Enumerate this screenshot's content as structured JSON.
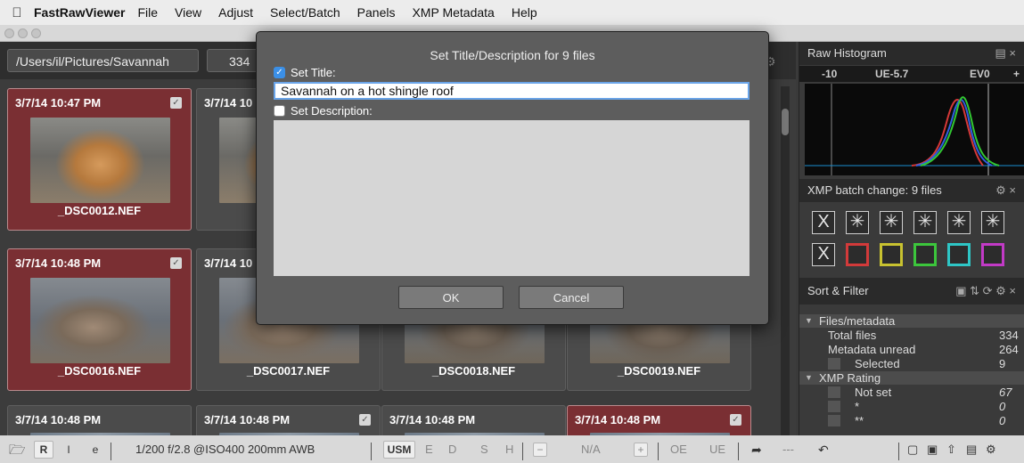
{
  "menubar": {
    "app_name": "FastRawViewer",
    "items": [
      "File",
      "View",
      "Adjust",
      "Select/Batch",
      "Panels",
      "XMP Metadata",
      "Help"
    ]
  },
  "pathbar": {
    "path": "/Users/il/Pictures/Savannah",
    "count": "334"
  },
  "thumbnails": [
    {
      "time": "3/7/14 10:47 PM",
      "file": "_DSC0012.NEF"
    },
    {
      "time": "3/7/14 10",
      "file": "_D"
    },
    {
      "time": "3/7/14 10:48 PM",
      "file": "_DSC0016.NEF"
    },
    {
      "time": "3/7/14 10",
      "file": "_DSC0017.NEF"
    },
    {
      "time": "",
      "file": "_DSC0018.NEF"
    },
    {
      "time": "",
      "file": "_DSC0019.NEF"
    },
    {
      "time": "3/7/14 10:48 PM",
      "file": ""
    },
    {
      "time": "3/7/14 10:48 PM",
      "file": ""
    },
    {
      "time": "3/7/14 10:48 PM",
      "file": ""
    },
    {
      "time": "3/7/14 10:48 PM",
      "file": ""
    }
  ],
  "dialog": {
    "title": "Set Title/Description for 9 files",
    "set_title_label": "Set Title:",
    "title_value": "Savannah on a hot shingle roof",
    "set_description_label": "Set Description:",
    "description_value": "",
    "ok_label": "OK",
    "cancel_label": "Cancel"
  },
  "histogram": {
    "header": "Raw Histogram",
    "labels": {
      "l1": "-10",
      "l2": "UE-5.7",
      "l3": "EV0",
      "l4": "+"
    }
  },
  "xmp_batch": {
    "header": "XMP batch change: 9 files",
    "clear_glyph": "X",
    "star_glyph": "✳"
  },
  "colors": {
    "red": "#d23a3a",
    "yellow": "#c8c230",
    "green": "#3cc63c",
    "cyan": "#2ec6c6",
    "purple": "#c23ac6",
    "selected": "#7a2f33",
    "accent": "#3b8fe6"
  },
  "sort_filter": {
    "header": "Sort & Filter",
    "files_metadata": "Files/metadata",
    "total_files_label": "Total files",
    "total_files": "334",
    "metadata_unread_label": "Metadata unread",
    "metadata_unread": "264",
    "selected_label": "Selected",
    "selected": "9",
    "xmp_rating": "XMP Rating",
    "not_set_label": "Not set",
    "not_set": "67",
    "one_star_label": "*",
    "one_star": "0",
    "two_star_label": "**",
    "two_star": "0"
  },
  "bottombar": {
    "r": "R",
    "i": "I",
    "e": "e",
    "exif": "1/200 f/2.8 @ISO400 200mm AWB",
    "usm": "USM",
    "E": "E",
    "D": "D",
    "S": "S",
    "H": "H",
    "minus": "−",
    "na": "N/A",
    "plus": "+",
    "oe": "OE",
    "ue": "UE",
    "dashes": "---"
  }
}
